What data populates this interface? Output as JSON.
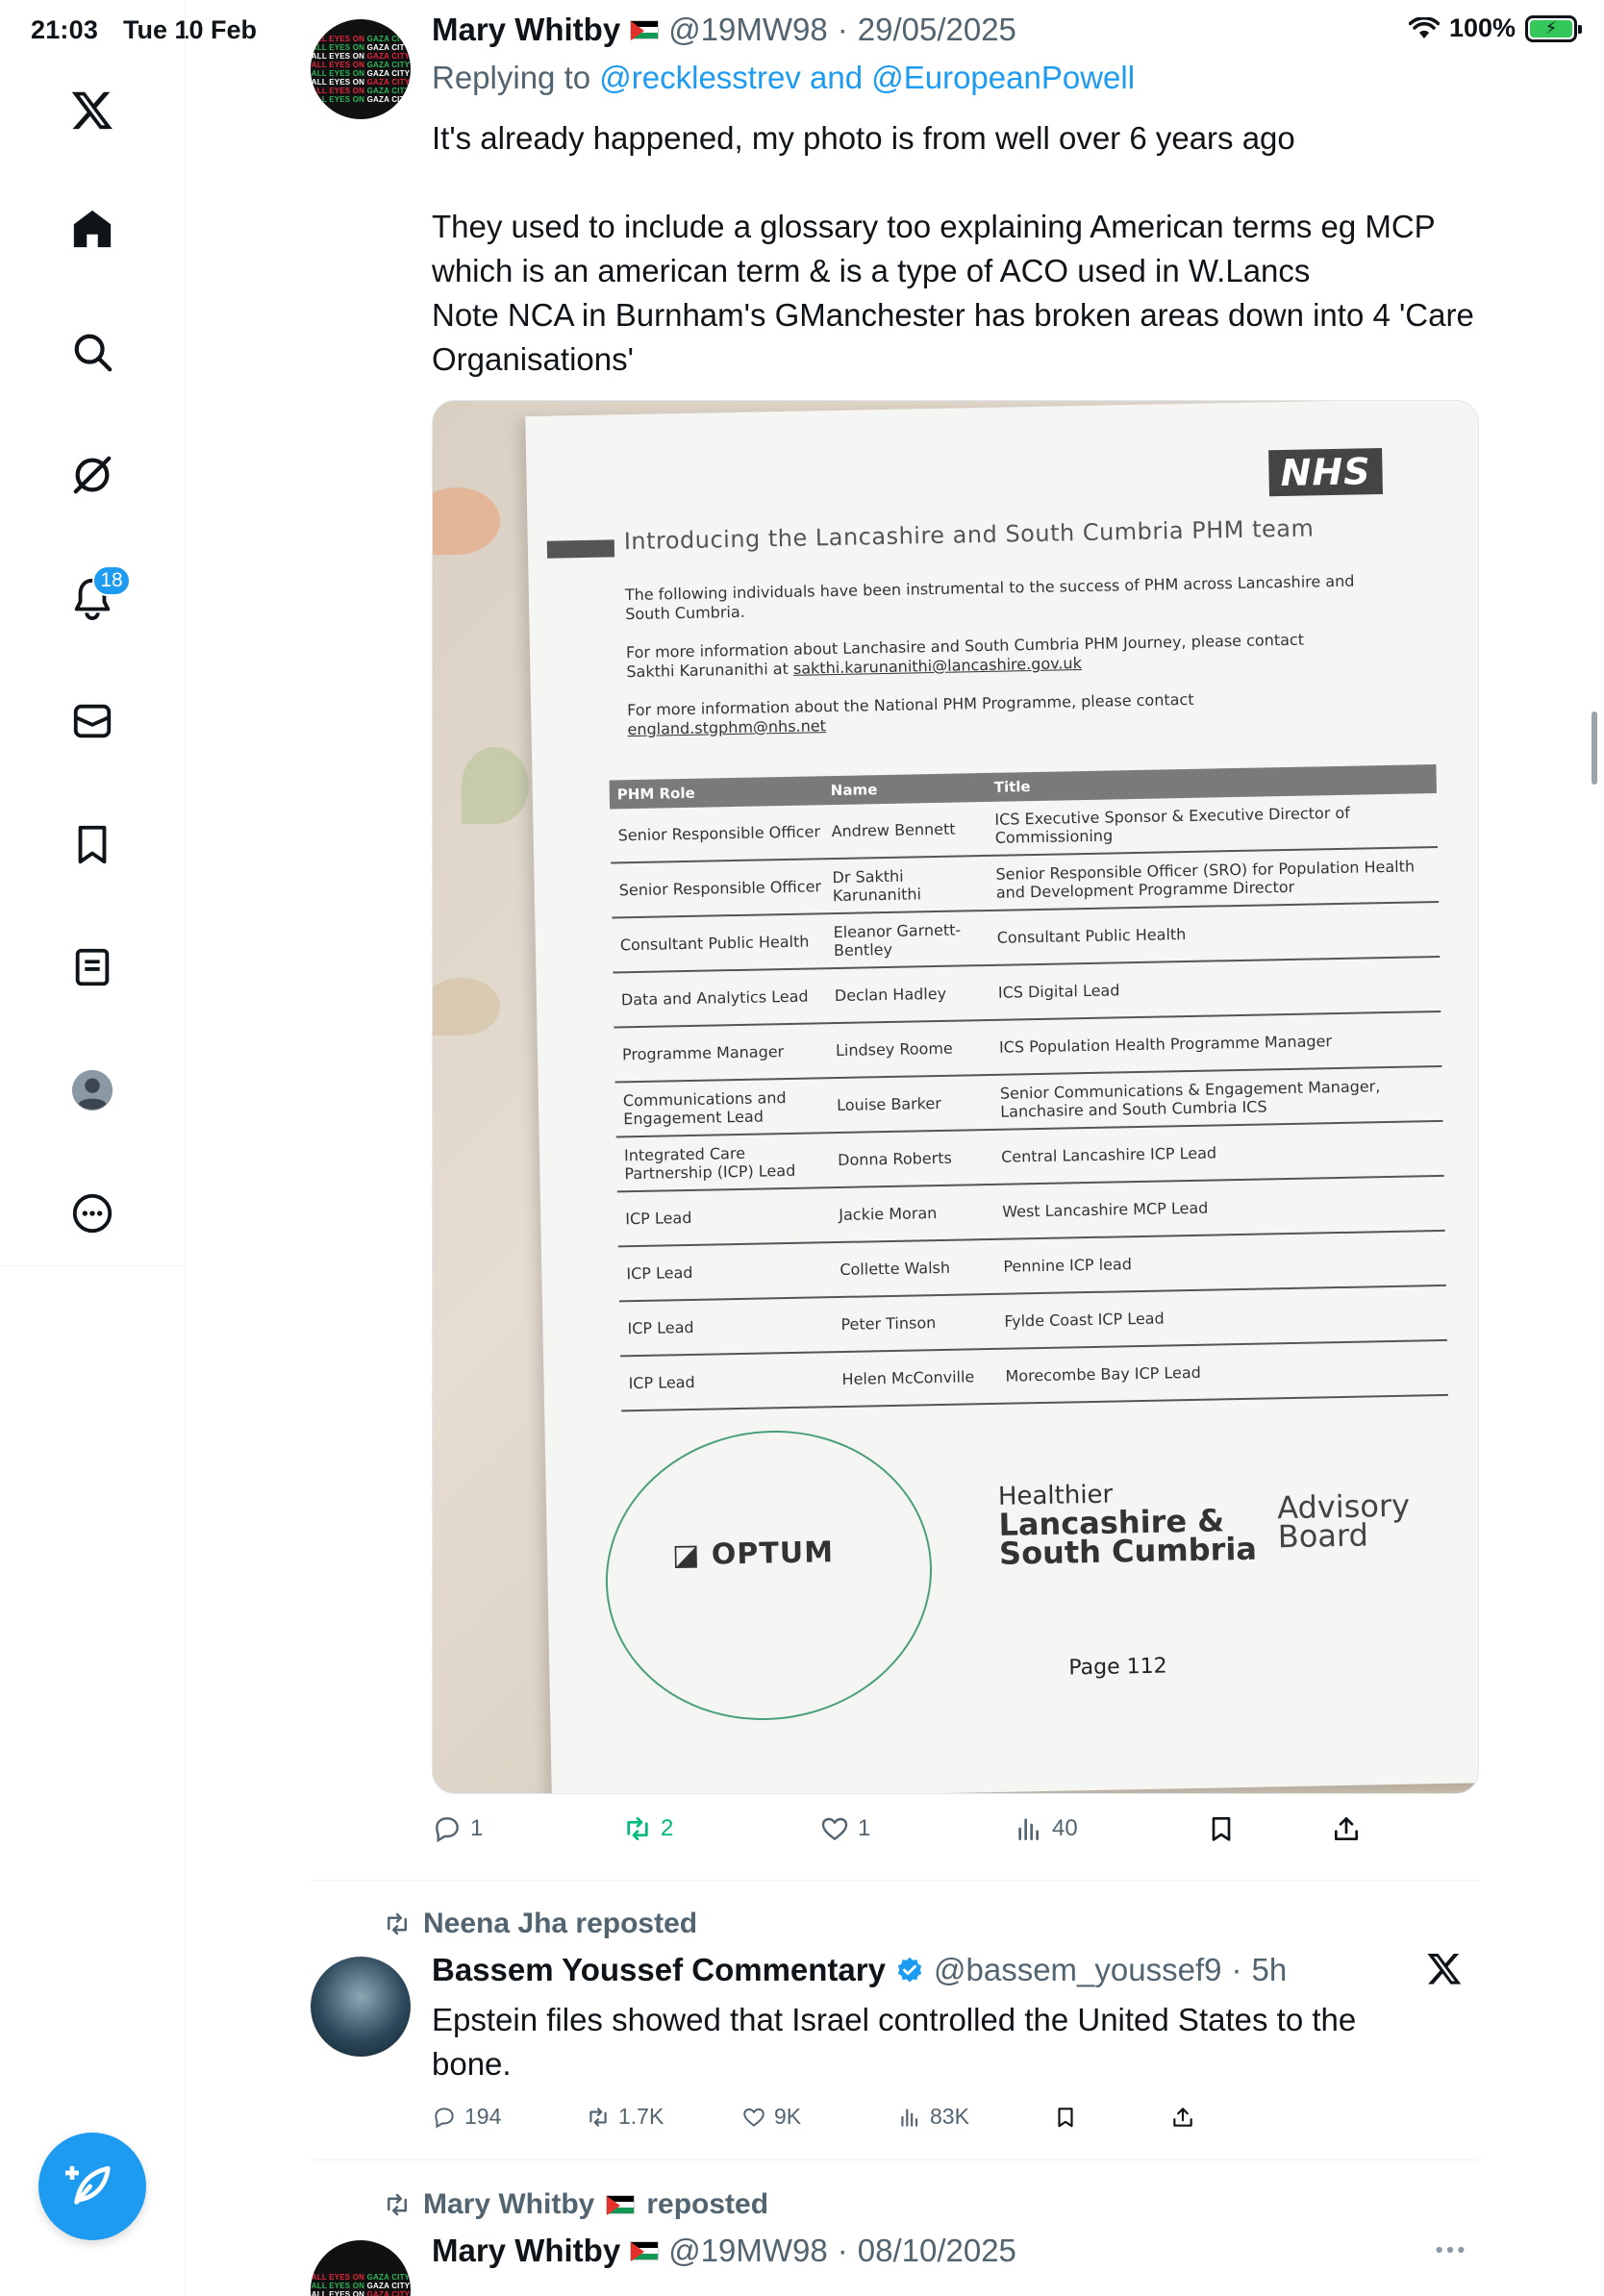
{
  "status_bar": {
    "time": "21:03",
    "date": "Tue 10 Feb",
    "battery": "100%"
  },
  "nav": {
    "notifications_badge": "18"
  },
  "tweets": [
    {
      "name": "Mary Whitby",
      "handle": "@19MW98",
      "date": "29/05/2025",
      "replying_prefix": "Replying to",
      "replying_to": "@recklesstrev and @EuropeanPowell",
      "body": [
        "It's already happened, my photo is from well over 6 years ago",
        "They used to include a glossary too explaining American terms eg MCP which is an american term & is a type of ACO used in W.Lancs",
        "Note NCA in Burnham's GManchester has broken areas down into 4 'Care Organisations'"
      ],
      "actions": {
        "replies": "1",
        "reposts": "2",
        "likes": "1",
        "views": "40"
      }
    },
    {
      "reposted_by": "Neena Jha reposted",
      "name": "Bassem Youssef Commentary",
      "handle": "@bassem_youssef9",
      "date": "5h",
      "body": "Epstein files showed that Israel controlled the United States to the bone.",
      "actions": {
        "replies": "194",
        "reposts": "1.7K",
        "likes": "9K",
        "views": "83K"
      }
    },
    {
      "reposted_by": "Mary Whitby",
      "reposted_suffix": "reposted",
      "name": "Mary Whitby",
      "handle": "@19MW98",
      "date": "08/10/2025"
    }
  ],
  "avatar_text": {
    "line1": "ALL EYES ON",
    "line2": "GAZA CITY"
  },
  "document": {
    "logo": "NHS",
    "title": "Introducing the Lancashire and South Cumbria PHM team",
    "para1": "The following individuals have been instrumental to the success of PHM across Lancashire and South Cumbria.",
    "para2": "For more information about Lanchasire and South Cumbria PHM Journey, please contact Sakthi Karunanithi at",
    "para2_email": "sakthi.karunanithi@lancashire.gov.uk",
    "para3": "For more information about the National PHM Programme, please contact",
    "para3_email": "england.stgphm@nhs.net",
    "columns": [
      "PHM Role",
      "Name",
      "Title"
    ],
    "rows": [
      [
        "Senior Responsible Officer",
        "Andrew Bennett",
        "ICS Executive Sponsor & Executive Director of Commissioning"
      ],
      [
        "Senior Responsible Officer",
        "Dr Sakthi Karunanithi",
        "Senior Responsible Officer (SRO) for Population Health and Development Programme Director"
      ],
      [
        "Consultant Public Health",
        "Eleanor Garnett-Bentley",
        "Consultant Public Health"
      ],
      [
        "Data and Analytics Lead",
        "Declan Hadley",
        "ICS Digital Lead"
      ],
      [
        "Programme Manager",
        "Lindsey Roome",
        "ICS Population Health Programme Manager"
      ],
      [
        "Communications and Engagement Lead",
        "Louise Barker",
        "Senior Communications & Engagement Manager, Lanchasire and South Cumbria ICS"
      ],
      [
        "Integrated Care Partnership (ICP) Lead",
        "Donna Roberts",
        "Central Lancashire ICP Lead"
      ],
      [
        "ICP Lead",
        "Jackie Moran",
        "West Lancashire MCP Lead"
      ],
      [
        "ICP Lead",
        "Collette Walsh",
        "Pennine ICP lead"
      ],
      [
        "ICP Lead",
        "Peter Tinson",
        "Fylde Coast ICP Lead"
      ],
      [
        "ICP Lead",
        "Helen McConville",
        "Morecombe Bay ICP Lead"
      ]
    ],
    "optum": "OPTUM",
    "healthier_small": "Healthier",
    "healthier_big1": "Lancashire &",
    "healthier_big2": "South Cumbria",
    "advisory1": "Advisory",
    "advisory2": "Board",
    "page": "Page 112"
  },
  "colors": {
    "accent": "#1d9bf0",
    "repost_active": "#00ba7c",
    "muted": "#536471"
  }
}
